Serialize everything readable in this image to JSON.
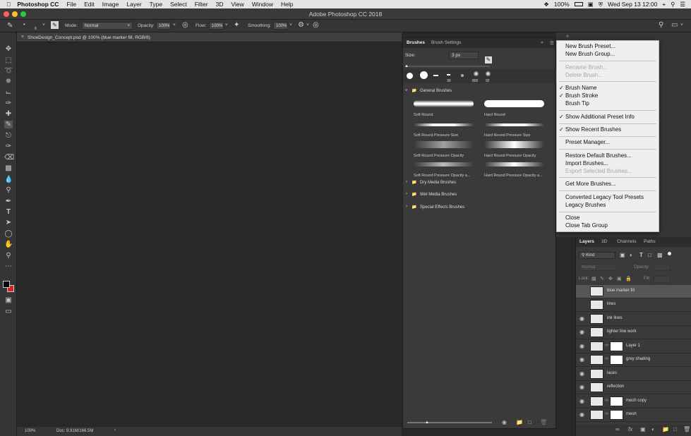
{
  "menubar": {
    "apple": "",
    "app_name": "Photoshop CC",
    "items": [
      "File",
      "Edit",
      "Image",
      "Layer",
      "Type",
      "Select",
      "Filter",
      "3D",
      "View",
      "Window",
      "Help"
    ],
    "battery": "100%",
    "clock": "Wed Sep 13  12:00"
  },
  "window": {
    "title": "Adobe Photoshop CC 2018"
  },
  "options": {
    "mode_label": "Mode:",
    "mode_value": "Normal",
    "opacity_label": "Opacity:",
    "opacity_value": "100%",
    "flow_label": "Flow:",
    "flow_value": "100%",
    "smoothing_label": "Smoothing:",
    "smoothing_value": "100%",
    "brush_size": "8"
  },
  "document": {
    "tab": "ShoeDesign_Concept.psd @ 100% (blue marker fill, RGB/8)",
    "zoom": "100%",
    "doc_info": "Doc: 9.91M/166.5M"
  },
  "brushes_panel": {
    "tabs": [
      "Brushes",
      "Brush Settings"
    ],
    "size_label": "Size:",
    "size_value": "3 px",
    "recent_sizes": [
      "30",
      "",
      "30",
      "",
      "800",
      "92"
    ],
    "groups": [
      "General Brushes",
      "Dry Media Brushes",
      "Wet Media Brushes",
      "Special Effects Brushes"
    ],
    "presets": [
      "Soft Round",
      "Hard Round",
      "Soft Round Pressure Size",
      "Hard Round Pressure Size",
      "Soft Round Pressure Opacity",
      "Hard Round Pressure Opacity",
      "Soft Round Pressure Opacity a...",
      "Hard Round Pressure Opacity a..."
    ]
  },
  "panel_menu": {
    "items": [
      {
        "label": "New Brush Preset...",
        "enabled": true,
        "checked": false
      },
      {
        "label": "New Brush Group...",
        "enabled": true,
        "checked": false
      },
      {
        "label": "Rename Brush...",
        "enabled": false,
        "checked": false
      },
      {
        "label": "Delete Brush...",
        "enabled": false,
        "checked": false
      },
      {
        "label": "Brush Name",
        "enabled": true,
        "checked": true
      },
      {
        "label": "Brush Stroke",
        "enabled": true,
        "checked": true
      },
      {
        "label": "Brush Tip",
        "enabled": true,
        "checked": false
      },
      {
        "label": "Show Additional Preset Info",
        "enabled": true,
        "checked": true
      },
      {
        "label": "Show Recent Brushes",
        "enabled": true,
        "checked": true
      },
      {
        "label": "Preset Manager...",
        "enabled": true,
        "checked": false
      },
      {
        "label": "Restore Default Brushes...",
        "enabled": true,
        "checked": false
      },
      {
        "label": "Import Brushes...",
        "enabled": true,
        "checked": false
      },
      {
        "label": "Export Selected Brushes...",
        "enabled": false,
        "checked": false
      },
      {
        "label": "Get More Brushes...",
        "enabled": true,
        "checked": false
      },
      {
        "label": "Converted Legacy Tool Presets",
        "enabled": true,
        "checked": false
      },
      {
        "label": "Legacy Brushes",
        "enabled": true,
        "checked": false
      },
      {
        "label": "Close",
        "enabled": true,
        "checked": false
      },
      {
        "label": "Close Tab Group",
        "enabled": true,
        "checked": false
      }
    ]
  },
  "layers_panel": {
    "tabs": [
      "Layers",
      "3D",
      "Channels",
      "Paths"
    ],
    "filter": "Kind",
    "blend": "Normal",
    "opacity_label": "Opacity:",
    "lock_label": "Lock:",
    "fill_label": "Fill:",
    "layers": [
      "blue marker fill",
      "lines",
      "ink lines",
      "lighter line work",
      "Layer 1",
      "grey shading",
      "laces",
      "reflection",
      "mesh copy",
      "mesh"
    ]
  },
  "colors": {
    "foreground": "#000000",
    "background": "#e02020",
    "accent": "#4a90d9"
  }
}
